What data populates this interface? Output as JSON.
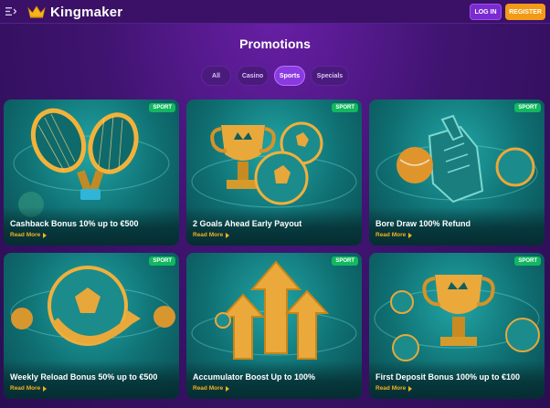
{
  "header": {
    "brand": "Kingmaker",
    "login_label": "LOG IN",
    "register_label": "REGISTER",
    "icons": [
      "menu-icon",
      "crown-icon"
    ],
    "colors": {
      "login": "#7a2bd1",
      "register": "#f39a16",
      "badge": "#12b85f",
      "link": "#f5b21d"
    }
  },
  "page": {
    "title": "Promotions"
  },
  "tabs": [
    {
      "label": "All",
      "active": false
    },
    {
      "label": "Casino",
      "active": false
    },
    {
      "label": "Sports",
      "active": true
    },
    {
      "label": "Specials",
      "active": false
    }
  ],
  "cards": [
    {
      "badge": "SPORT",
      "title": "Cashback Bonus 10% up to €500",
      "link": "Read More",
      "art": "tennis-rackets-icon"
    },
    {
      "badge": "SPORT",
      "title": "2 Goals Ahead Early Payout",
      "link": "Read More",
      "art": "trophy-balls-icon"
    },
    {
      "badge": "SPORT",
      "title": "Bore Draw 100% Refund",
      "link": "Read More",
      "art": "foam-hand-icon"
    },
    {
      "badge": "SPORT",
      "title": "Weekly Reload Bonus 50% up to €500",
      "link": "Read More",
      "art": "football-reload-icon"
    },
    {
      "badge": "SPORT",
      "title": "Accumulator Boost Up to 100%",
      "link": "Read More",
      "art": "boost-arrows-icon"
    },
    {
      "badge": "SPORT",
      "title": "First Deposit Bonus 100% up to €100",
      "link": "Read More",
      "art": "trophy-icon"
    }
  ]
}
